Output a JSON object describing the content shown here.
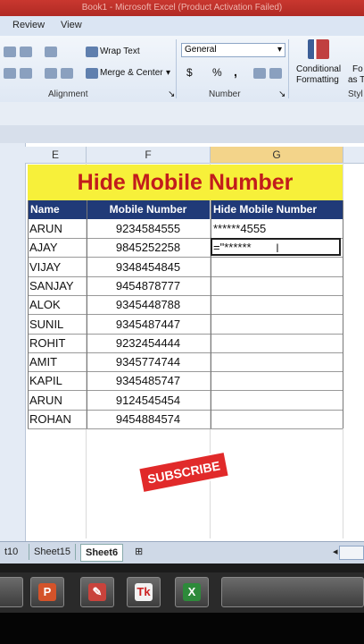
{
  "window": {
    "title": "Book1 - Microsoft Excel (Product Activation Failed)"
  },
  "ribbon": {
    "tabs": [
      "Review",
      "View"
    ],
    "wrap_text": "Wrap Text",
    "merge_center": "Merge & Center",
    "number_format": "General",
    "currency": "$",
    "percent": "%",
    "comma": ",",
    "conditional_formatting": "Conditional",
    "conditional_formatting_2": "Formatting",
    "format_as": "Fo",
    "format_as_2": "as T",
    "styles_short": "Styl",
    "groups": {
      "alignment": "Alignment",
      "number": "Number"
    }
  },
  "sheet": {
    "columns": [
      "E",
      "F",
      "G"
    ],
    "banner": "Hide Mobile Number",
    "headers": [
      "Name",
      "Mobile Number",
      "Hide Mobile Number"
    ],
    "rows": [
      {
        "name": "ARUN",
        "mobile": "9234584555",
        "hidden": "******4555"
      },
      {
        "name": "AJAY",
        "mobile": "9845252258",
        "hidden": "=\"******"
      },
      {
        "name": "VIJAY",
        "mobile": "9348454845",
        "hidden": ""
      },
      {
        "name": "SANJAY",
        "mobile": "9454878777",
        "hidden": ""
      },
      {
        "name": "ALOK",
        "mobile": "9345448788",
        "hidden": ""
      },
      {
        "name": "SUNIL",
        "mobile": "9345487447",
        "hidden": ""
      },
      {
        "name": "ROHIT",
        "mobile": "9232454444",
        "hidden": ""
      },
      {
        "name": "AMIT",
        "mobile": "9345774744",
        "hidden": ""
      },
      {
        "name": "KAPIL",
        "mobile": "9345485747",
        "hidden": ""
      },
      {
        "name": "ARUN",
        "mobile": "9124545454",
        "hidden": ""
      },
      {
        "name": "ROHAN",
        "mobile": "9454884574",
        "hidden": ""
      }
    ]
  },
  "overlay": {
    "subscribe": "SUBSCRIBE"
  },
  "sheet_tabs": [
    "t10",
    "Sheet15",
    "Sheet6"
  ],
  "taskbar": {
    "items": [
      "powerpoint-icon",
      "paint-icon",
      "typing-icon",
      "excel-icon"
    ]
  },
  "colors": {
    "banner_bg": "#f7f03a",
    "banner_text": "#c21c1c",
    "header_bg": "#203a78",
    "subscribe_bg": "#e12a2a"
  }
}
